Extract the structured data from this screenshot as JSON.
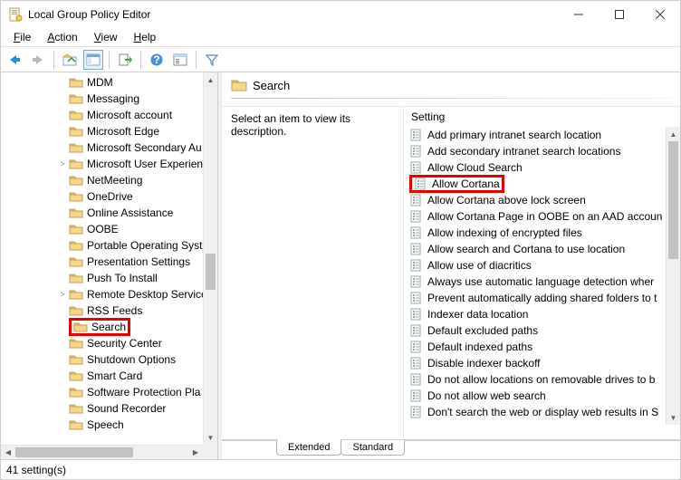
{
  "window": {
    "title": "Local Group Policy Editor"
  },
  "menu": {
    "file": "File",
    "action": "Action",
    "view": "View",
    "help": "Help"
  },
  "tree": {
    "items": [
      {
        "label": "MDM",
        "indent": 78,
        "exp": ""
      },
      {
        "label": "Messaging",
        "indent": 78,
        "exp": ""
      },
      {
        "label": "Microsoft account",
        "indent": 78,
        "exp": ""
      },
      {
        "label": "Microsoft Edge",
        "indent": 78,
        "exp": ""
      },
      {
        "label": "Microsoft Secondary Au",
        "indent": 78,
        "exp": ""
      },
      {
        "label": "Microsoft User Experien",
        "indent": 78,
        "exp": ">"
      },
      {
        "label": "NetMeeting",
        "indent": 78,
        "exp": ""
      },
      {
        "label": "OneDrive",
        "indent": 78,
        "exp": ""
      },
      {
        "label": "Online Assistance",
        "indent": 78,
        "exp": ""
      },
      {
        "label": "OOBE",
        "indent": 78,
        "exp": ""
      },
      {
        "label": "Portable Operating Syst",
        "indent": 78,
        "exp": ""
      },
      {
        "label": "Presentation Settings",
        "indent": 78,
        "exp": ""
      },
      {
        "label": "Push To Install",
        "indent": 78,
        "exp": ""
      },
      {
        "label": "Remote Desktop Service",
        "indent": 78,
        "exp": ">"
      },
      {
        "label": "RSS Feeds",
        "indent": 78,
        "exp": ""
      },
      {
        "label": "Search",
        "indent": 78,
        "exp": "",
        "highlight": true
      },
      {
        "label": "Security Center",
        "indent": 78,
        "exp": ""
      },
      {
        "label": "Shutdown Options",
        "indent": 78,
        "exp": ""
      },
      {
        "label": "Smart Card",
        "indent": 78,
        "exp": ""
      },
      {
        "label": "Software Protection Pla",
        "indent": 78,
        "exp": ""
      },
      {
        "label": "Sound Recorder",
        "indent": 78,
        "exp": ""
      },
      {
        "label": "Speech",
        "indent": 78,
        "exp": ""
      }
    ]
  },
  "detail": {
    "header_title": "Search",
    "description_prompt": "Select an item to view its description.",
    "settings_header": "Setting",
    "settings": [
      {
        "label": "Add primary intranet search location"
      },
      {
        "label": "Add secondary intranet search locations"
      },
      {
        "label": "Allow Cloud Search"
      },
      {
        "label": "Allow Cortana",
        "highlight": true
      },
      {
        "label": "Allow Cortana above lock screen"
      },
      {
        "label": "Allow Cortana Page in OOBE on an AAD accoun"
      },
      {
        "label": "Allow indexing of encrypted files"
      },
      {
        "label": "Allow search and Cortana to use location"
      },
      {
        "label": "Allow use of diacritics"
      },
      {
        "label": "Always use automatic language detection wher"
      },
      {
        "label": "Prevent automatically adding shared folders to t"
      },
      {
        "label": "Indexer data location"
      },
      {
        "label": "Default excluded paths"
      },
      {
        "label": "Default indexed paths"
      },
      {
        "label": "Disable indexer backoff"
      },
      {
        "label": "Do not allow locations on removable drives to b"
      },
      {
        "label": "Do not allow web search"
      },
      {
        "label": "Don't search the web or display web results in S"
      }
    ]
  },
  "tabs": {
    "extended": "Extended",
    "standard": "Standard"
  },
  "status": {
    "text": "41 setting(s)"
  }
}
